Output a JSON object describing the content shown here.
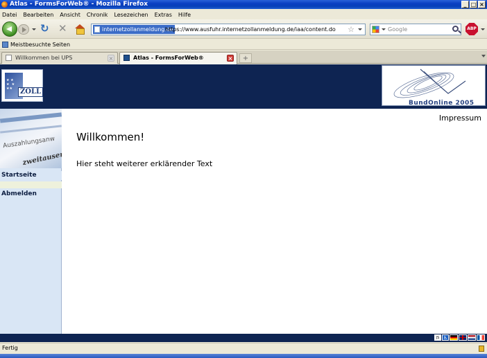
{
  "window": {
    "title": "Atlas - FormsForWeb® - Mozilla Firefox",
    "controls": {
      "minimize": "_",
      "maximize": "□",
      "close": "×"
    }
  },
  "menu": {
    "items": [
      "Datei",
      "Bearbeiten",
      "Ansicht",
      "Chronik",
      "Lesezeichen",
      "Extras",
      "Hilfe"
    ]
  },
  "toolbar": {
    "identity": "internetzollanmeldung.de",
    "url": "https://www.ausfuhr.internetzollanmeldung.de/iaa/content.do",
    "star": "☆",
    "search_placeholder": "Google",
    "abp_label": "ABP",
    "reload_glyph": "↻",
    "stop_glyph": "✕"
  },
  "bookmarks": {
    "items": [
      "Meistbesuchte Seiten"
    ]
  },
  "tabs": [
    {
      "label": "Willkommen bei UPS",
      "active": false
    },
    {
      "label": "Atlas - FormsForWeb®",
      "active": true
    }
  ],
  "tab_close_glyph": "×",
  "new_tab_glyph": "+",
  "page": {
    "header": {
      "zoll_logo_text": "ZOLL",
      "bund_logo_text": "BundOnline 2005"
    },
    "sidebar": {
      "image_text_1": "Auszahlungsanw",
      "image_text_2": "zweitausend",
      "nav": [
        "Startseite",
        "Abmelden"
      ]
    },
    "impressum": "Impressum",
    "welcome": "Willkommen!",
    "subtext": "Hier steht weiterer erklärender Text",
    "footer": {
      "js_label": "JS",
      "accessibility_glyph": "♿"
    }
  },
  "status": {
    "text": "Fertig"
  }
}
